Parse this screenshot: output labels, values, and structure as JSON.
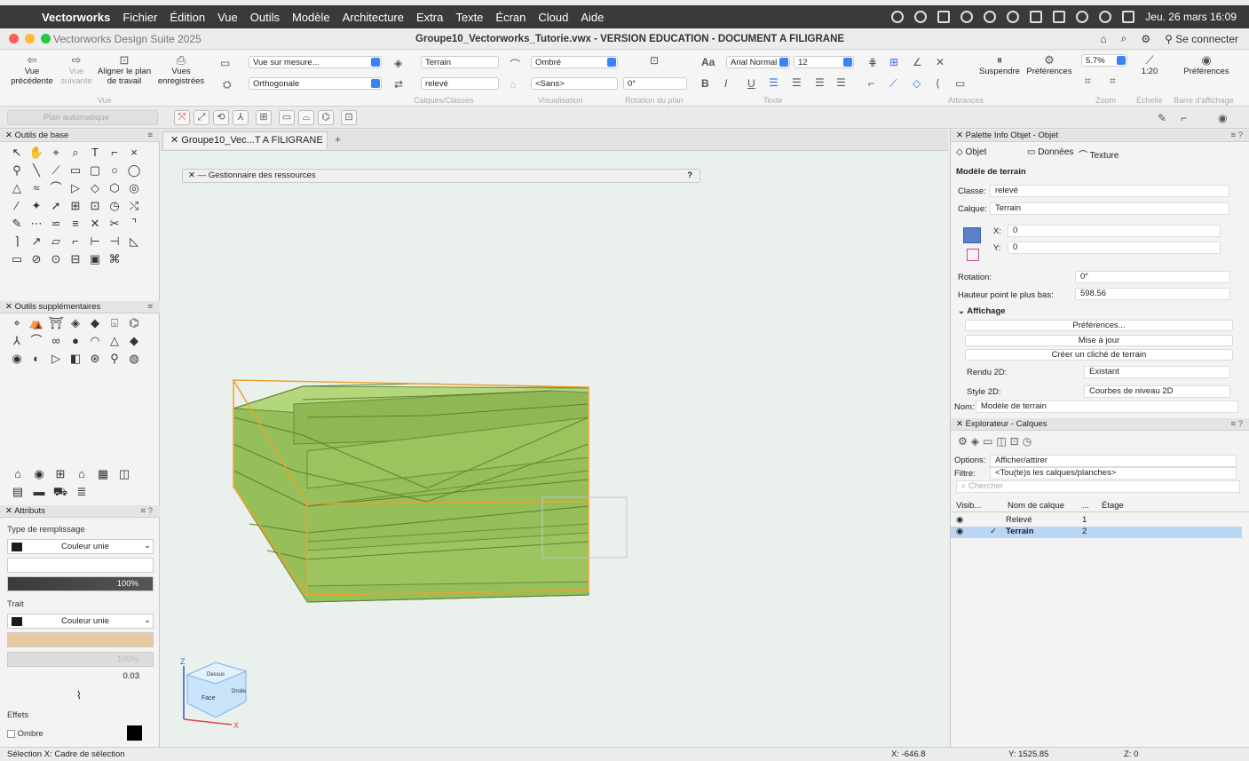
{
  "menubar": {
    "app": "Vectorworks",
    "items": [
      "Fichier",
      "Édition",
      "Vue",
      "Outils",
      "Modèle",
      "Architecture",
      "Extra",
      "Texte",
      "Écran",
      "Cloud",
      "Aide"
    ],
    "clock": "Jeu. 26 mars 16:09"
  },
  "titlebar": {
    "suite": "Vectorworks Design Suite 2025",
    "document": "Groupe10_Vectorworks_Tutorie.vwx - VERSION EDUCATION - DOCUMENT A FILIGRANE",
    "connect": "Se connecter"
  },
  "toolbar": {
    "prev_view": "Vue précédente",
    "next_view": "Vue suivante",
    "align_plan": "Aligner le plan de travail",
    "saved_views": "Vues enregistrées",
    "group_vue": "Vue",
    "custom_view": "Vue sur mesure...",
    "projection": "Orthogonale",
    "class_menu": "Terrain",
    "layer_menu": "relevé",
    "group_calques": "Calques/Classes",
    "render": "Ombré",
    "render2": "<Sans>",
    "group_visu": "Visualisation",
    "rotation": "0°",
    "group_rotation": "Rotation du plan",
    "font": "Arial Normal",
    "size": "12",
    "group_text": "Texte",
    "bold": "B",
    "italic": "I",
    "underline": "U",
    "group_snap": "Attirances",
    "suspend": "Suspendre",
    "prefs": "Préférences",
    "zoom": "5.7%",
    "group_zoom": "Zoom",
    "scale": "1:20",
    "group_scale": "Échelle",
    "prefs2": "Préférences",
    "group_display": "Barre d'affichage",
    "plan_auto": "Plan automatique"
  },
  "left": {
    "tools_title": "Outils de base",
    "tools": [
      "↖",
      "✋",
      "⌖",
      "⌕",
      "T",
      "⌐",
      "×",
      "⚲",
      "╲",
      "⟋",
      "▭",
      "▢",
      "○",
      "◯",
      "△",
      "≈",
      "⌒",
      "▷",
      "◇",
      "⬡",
      "◎",
      "⁄",
      "✦",
      "➚",
      "⊞",
      "⊡",
      "◷",
      "⤭",
      "✎",
      "⋯",
      "⋍",
      "≡",
      "✕",
      "✂",
      "⌝",
      "⌉",
      "↗",
      "▱",
      "⌐",
      "⊢",
      "⊣",
      "◺",
      "▭",
      "⊘",
      "⊙",
      "⊟",
      "▣",
      "⌘"
    ],
    "extra_title": "Outils supplémentaires",
    "extra_tools": [
      "⌖",
      "⛺",
      "⛩",
      "◈",
      "◆",
      "⌺",
      "⌬",
      "⅄",
      "⌒",
      "∞",
      "●",
      "◠",
      "△",
      "◆",
      "◉",
      "◐",
      "▷",
      "◧",
      "⊛",
      "⚲",
      "◍"
    ],
    "bottom_icons": [
      "⌂",
      "◉",
      "⊞",
      "⌂",
      "▦",
      "◫",
      "▤",
      "▬",
      "⛟",
      "≣"
    ],
    "attr_title": "Attributs",
    "fill_type": "Type de remplissage",
    "fill_value": "Couleur unie",
    "opacity": "100%",
    "stroke": "Trait",
    "stroke_value": "Couleur unie",
    "opacity2": "100%",
    "thickness": "0.03",
    "effects": "Effets",
    "shadow": "Ombre"
  },
  "tab": {
    "label": "Groupe10_Vec...T A FILIGRANE",
    "plus": "+"
  },
  "resource_manager": {
    "title": "Gestionnaire des ressources",
    "help": "?"
  },
  "cube": {
    "face_front": "Face",
    "face_top": "Dessus",
    "face_right": "Droite",
    "axis_z": "Z",
    "axis_x": "X"
  },
  "obj": {
    "palette_title": "Palette Info Objet - Objet",
    "tab_object": "Objet",
    "tab_data": "Données",
    "tab_texture": "Texture",
    "kind": "Modèle de terrain",
    "class_label": "Classe:",
    "class_value": "relevé",
    "layer_label": "Calque:",
    "layer_value": "Terrain",
    "x_label": "X:",
    "x_value": "0",
    "y_label": "Y:",
    "y_value": "0",
    "rotation_label": "Rotation:",
    "rotation_value": "0°",
    "low_label": "Hauteur point le plus bas:",
    "low_value": "598.56",
    "display_section": "Affichage",
    "btn_prefs": "Préférences...",
    "btn_update": "Mise à jour",
    "btn_snapshot": "Créer un cliché de terrain",
    "render2d_label": "Rendu 2D:",
    "render2d_value": "Existant",
    "style2d_label": "Style 2D:",
    "style2d_value": "Courbes de niveau 2D",
    "name_label": "Nom:",
    "name_value": "Modèle de terrain"
  },
  "layers": {
    "title": "Explorateur - Calques",
    "options_label": "Options:",
    "options_value": "Afficher/attirer",
    "filter_label": "Filtre:",
    "filter_value": "<Tou(te)s les calques/planches>",
    "search_placeholder": "Chercher",
    "col_vis": "Visib...",
    "col_name": "Nom de calque",
    "col_dots": "...",
    "col_floor": "Étage",
    "rows": [
      {
        "name": "Relevé",
        "floor": "1",
        "active": false
      },
      {
        "name": "Terrain",
        "floor": "2",
        "active": true
      }
    ]
  },
  "status": {
    "left": "Sélection  X:  Cadre de sélection",
    "x": "X: -646.8",
    "y": "Y: 1525.85",
    "z": "Z: 0"
  }
}
